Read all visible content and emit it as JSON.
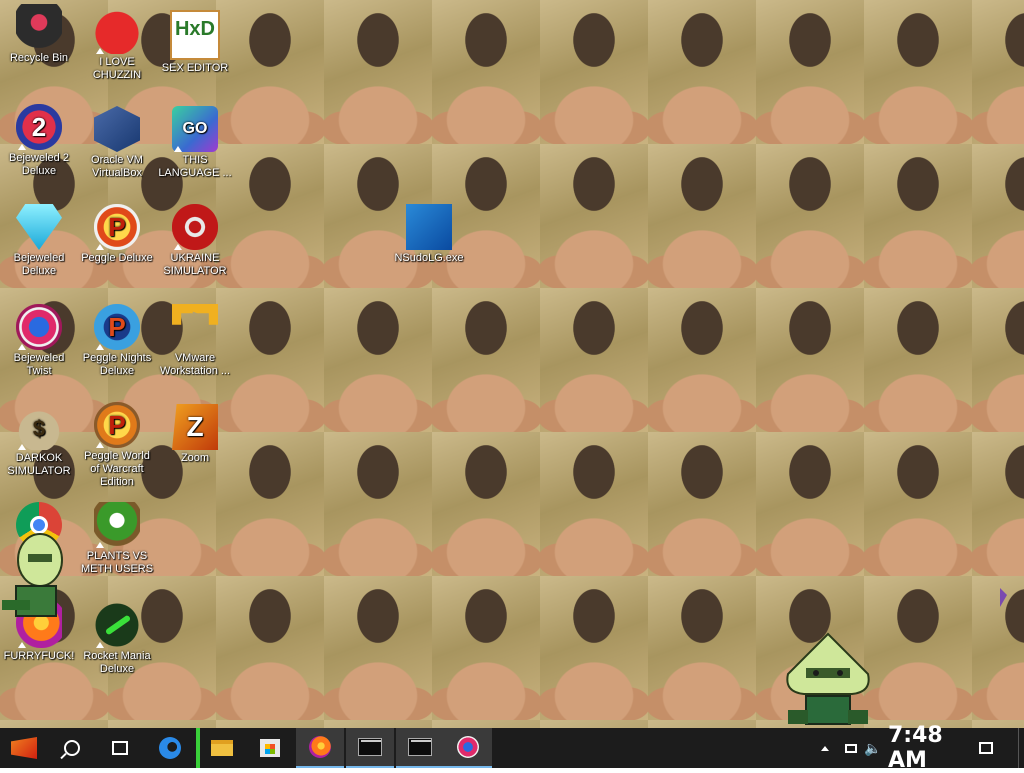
{
  "desktop": {
    "icons": [
      {
        "label": "Recycle Bin",
        "icon": "recycle-bin-icon"
      },
      {
        "label": "I LOVE CHUZZIN",
        "icon": "chuzzle-icon"
      },
      {
        "label": "SEX EDITOR",
        "icon": "hex-editor-icon",
        "glyph_text": "HxD"
      },
      {
        "label": "Bejeweled 2 Deluxe",
        "icon": "bejeweled-2-icon",
        "glyph_text": "2"
      },
      {
        "label": "Oracle VM VirtualBox",
        "icon": "virtualbox-icon"
      },
      {
        "label": "THIS LANGUAGE ...",
        "icon": "golang-icon",
        "glyph_text": "GO"
      },
      {
        "label": "Bejeweled Deluxe",
        "icon": "bejeweled-gem-icon"
      },
      {
        "label": "Peggle Deluxe",
        "icon": "peggle-icon",
        "glyph_text": "P"
      },
      {
        "label": "UKRAINE SIMULATOR",
        "icon": "radiation-icon"
      },
      {
        "label": "NSudoLG.exe",
        "icon": "nsudo-gear-icon"
      },
      {
        "label": "Bejeweled Twist",
        "icon": "bejeweled-twist-icon"
      },
      {
        "label": "Peggle Nights Deluxe",
        "icon": "peggle-nights-icon",
        "glyph_text": "P"
      },
      {
        "label": "VMware Workstation ...",
        "icon": "vmware-icon"
      },
      {
        "label": "DARKOK SIMULATOR",
        "icon": "money-bag-icon",
        "glyph_text": "$"
      },
      {
        "label": "Peggle World of Warcraft Edition",
        "icon": "peggle-wow-icon",
        "glyph_text": "P"
      },
      {
        "label": "Zoom",
        "icon": "zuma-icon",
        "glyph_text": "Z"
      },
      {
        "label": "",
        "icon": "chrome-icon"
      },
      {
        "label": "PLANTS VS METH USERS",
        "icon": "plants-vs-zombies-icon"
      },
      {
        "label": "FURRYFUCK!",
        "icon": "firefox-icon"
      },
      {
        "label": "Rocket Mania Deluxe",
        "icon": "rocket-mania-icon"
      }
    ]
  },
  "taskbar": {
    "items": [
      {
        "icon": "start-icon"
      },
      {
        "icon": "search-icon"
      },
      {
        "icon": "task-view-icon"
      },
      {
        "icon": "edge-icon"
      },
      {
        "icon": "file-explorer-icon"
      },
      {
        "icon": "microsoft-store-icon"
      },
      {
        "icon": "firefox-icon"
      },
      {
        "icon": "command-prompt-icon"
      },
      {
        "icon": "command-prompt-icon"
      },
      {
        "icon": "bejeweled-twist-icon"
      }
    ],
    "tray": {
      "clock": "7:48 AM"
    }
  }
}
